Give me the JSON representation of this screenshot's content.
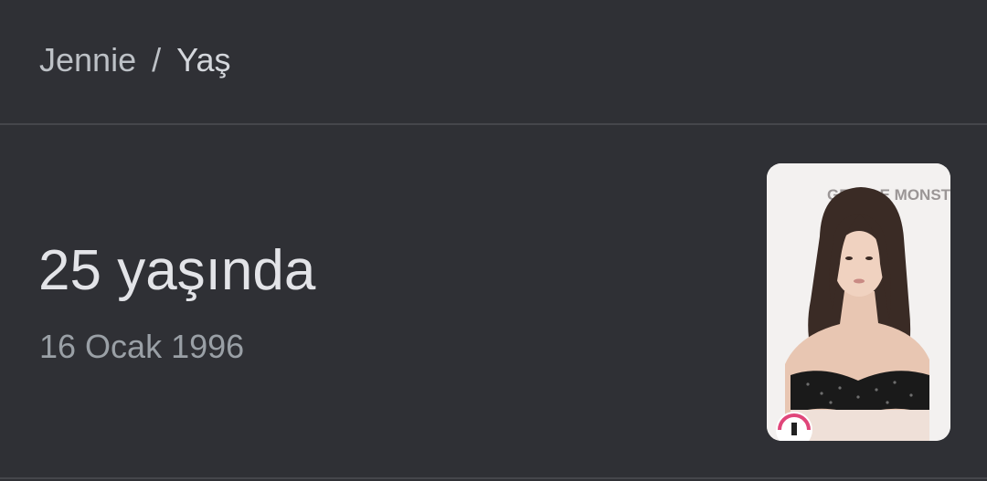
{
  "breadcrumb": {
    "parent": "Jennie",
    "separator": "/",
    "current": "Yaş"
  },
  "result": {
    "age": "25 yaşında",
    "birth_date": "16 Ocak 1996"
  },
  "thumbnail": {
    "backdrop_text": "GENTLE MONST",
    "icon": "person-photo"
  }
}
